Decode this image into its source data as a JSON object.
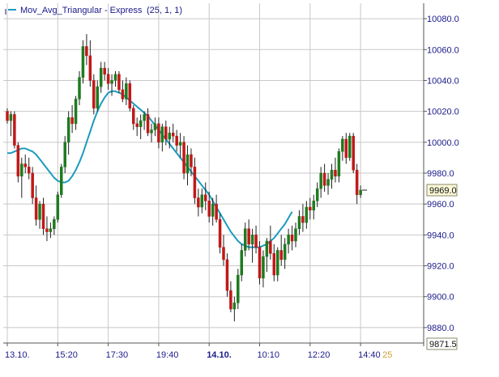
{
  "chart_data": {
    "type": "candlestick",
    "legend": {
      "label": "Mov_Avg_Triangular - Express",
      "params": "(25, 1, 1)",
      "color": "#1b9bbf"
    },
    "ylim": [
      9870,
      10090
    ],
    "y_ticks": [
      9880.0,
      9900.0,
      9920.0,
      9940.0,
      9960.0,
      9980.0,
      10000.0,
      10020.0,
      10040.0,
      10060.0,
      10080.0
    ],
    "y_tick_labels": [
      "9880.0",
      "9900.0",
      "9920.0",
      "9940.0",
      "9960.0",
      "9980.0",
      "10000.0",
      "10020.0",
      "10040.0",
      "10060.0",
      "10080.0"
    ],
    "x_ticks": [
      {
        "label": "13.10.",
        "index": 0,
        "bold": false
      },
      {
        "label": "15:20",
        "index": 14,
        "bold": false
      },
      {
        "label": "17:30",
        "index": 28,
        "bold": false
      },
      {
        "label": "19:40",
        "index": 42,
        "bold": false
      },
      {
        "label": "14.10.",
        "index": 56,
        "bold": true
      },
      {
        "label": "10:10",
        "index": 70,
        "bold": false
      },
      {
        "label": "12:20",
        "index": 84,
        "bold": false
      },
      {
        "label": "14:40",
        "index": 98,
        "bold": false
      }
    ],
    "x_extra_label": "25",
    "last_price": "9969.0",
    "min_price_label": "9871.5",
    "colors": {
      "up": "#1e7a1e",
      "down": "#c01818",
      "grid": "#c8c8c8",
      "ma": "#1b9bbf",
      "axis_text": "#1a1a8a"
    },
    "candles": [
      [
        10020,
        10022,
        10012,
        10014
      ],
      [
        10014,
        10020,
        10004,
        10018
      ],
      [
        10018,
        10020,
        9996,
        9998
      ],
      [
        9998,
        10000,
        9974,
        9978
      ],
      [
        9978,
        9990,
        9964,
        9986
      ],
      [
        9986,
        9992,
        9980,
        9984
      ],
      [
        9984,
        9990,
        9976,
        9980
      ],
      [
        9980,
        9984,
        9960,
        9964
      ],
      [
        9964,
        9972,
        9946,
        9950
      ],
      [
        9950,
        9962,
        9944,
        9960
      ],
      [
        9960,
        9964,
        9940,
        9944
      ],
      [
        9944,
        9952,
        9936,
        9942
      ],
      [
        9942,
        9948,
        9938,
        9944
      ],
      [
        9944,
        9952,
        9940,
        9950
      ],
      [
        9950,
        9968,
        9948,
        9966
      ],
      [
        9966,
        9986,
        9964,
        9984
      ],
      [
        9984,
        10004,
        9980,
        10000
      ],
      [
        10000,
        10020,
        9992,
        10016
      ],
      [
        10016,
        10024,
        10006,
        10012
      ],
      [
        10012,
        10030,
        10008,
        10028
      ],
      [
        10028,
        10046,
        10024,
        10042
      ],
      [
        10042,
        10066,
        10038,
        10062
      ],
      [
        10062,
        10070,
        10050,
        10056
      ],
      [
        10056,
        10066,
        10036,
        10040
      ],
      [
        10040,
        10044,
        10018,
        10022
      ],
      [
        10022,
        10040,
        10020,
        10036
      ],
      [
        10036,
        10052,
        10032,
        10048
      ],
      [
        10048,
        10052,
        10040,
        10044
      ],
      [
        10044,
        10048,
        10034,
        10038
      ],
      [
        10038,
        10044,
        10030,
        10040
      ],
      [
        10040,
        10046,
        10036,
        10044
      ],
      [
        10044,
        10046,
        10032,
        10034
      ],
      [
        10034,
        10040,
        10026,
        10028
      ],
      [
        10028,
        10042,
        10024,
        10038
      ],
      [
        10038,
        10040,
        10020,
        10022
      ],
      [
        10022,
        10024,
        10008,
        10012
      ],
      [
        10012,
        10016,
        10004,
        10010
      ],
      [
        10010,
        10018,
        10002,
        10014
      ],
      [
        10014,
        10020,
        10008,
        10018
      ],
      [
        10018,
        10022,
        10004,
        10006
      ],
      [
        10006,
        10012,
        10000,
        10008
      ],
      [
        10008,
        10016,
        10004,
        10012
      ],
      [
        10012,
        10016,
        9996,
        10000
      ],
      [
        10000,
        10012,
        9994,
        10010
      ],
      [
        10010,
        10014,
        9998,
        10002
      ],
      [
        10002,
        10010,
        9996,
        10006
      ],
      [
        10006,
        10012,
        10000,
        10004
      ],
      [
        10004,
        10008,
        9994,
        9998
      ],
      [
        9998,
        10006,
        9990,
        10000
      ],
      [
        10000,
        10004,
        9976,
        9980
      ],
      [
        9980,
        9998,
        9972,
        9992
      ],
      [
        9992,
        9996,
        9978,
        9984
      ],
      [
        9984,
        9990,
        9960,
        9964
      ],
      [
        9964,
        9970,
        9952,
        9958
      ],
      [
        9958,
        9970,
        9954,
        9966
      ],
      [
        9966,
        9974,
        9956,
        9962
      ],
      [
        9962,
        9968,
        9948,
        9952
      ],
      [
        9952,
        9964,
        9946,
        9960
      ],
      [
        9960,
        9966,
        9948,
        9950
      ],
      [
        9950,
        9954,
        9928,
        9932
      ],
      [
        9932,
        9940,
        9920,
        9924
      ],
      [
        9924,
        9928,
        9900,
        9904
      ],
      [
        9904,
        9910,
        9890,
        9892
      ],
      [
        9892,
        9900,
        9884,
        9896
      ],
      [
        9896,
        9918,
        9892,
        9914
      ],
      [
        9914,
        9934,
        9910,
        9930
      ],
      [
        9930,
        9948,
        9926,
        9944
      ],
      [
        9944,
        9950,
        9930,
        9934
      ],
      [
        9934,
        9944,
        9922,
        9940
      ],
      [
        9940,
        9946,
        9928,
        9932
      ],
      [
        9932,
        9936,
        9908,
        9912
      ],
      [
        9912,
        9930,
        9906,
        9926
      ],
      [
        9926,
        9938,
        9916,
        9936
      ],
      [
        9936,
        9946,
        9924,
        9928
      ],
      [
        9928,
        9934,
        9910,
        9914
      ],
      [
        9914,
        9932,
        9910,
        9930
      ],
      [
        9930,
        9940,
        9920,
        9924
      ],
      [
        9924,
        9938,
        9918,
        9934
      ],
      [
        9934,
        9944,
        9928,
        9940
      ],
      [
        9940,
        9946,
        9930,
        9936
      ],
      [
        9936,
        9948,
        9932,
        9944
      ],
      [
        9944,
        9956,
        9940,
        9952
      ],
      [
        9952,
        9960,
        9942,
        9948
      ],
      [
        9948,
        9962,
        9944,
        9958
      ],
      [
        9958,
        9964,
        9950,
        9956
      ],
      [
        9956,
        9966,
        9950,
        9962
      ],
      [
        9962,
        9974,
        9958,
        9970
      ],
      [
        9970,
        9984,
        9964,
        9980
      ],
      [
        9980,
        9986,
        9968,
        9972
      ],
      [
        9972,
        9980,
        9966,
        9976
      ],
      [
        9976,
        9986,
        9970,
        9982
      ],
      [
        9982,
        9990,
        9974,
        9978
      ],
      [
        9978,
        9996,
        9974,
        9994
      ],
      [
        9994,
        10004,
        9988,
        10002
      ],
      [
        10002,
        10006,
        9986,
        9990
      ],
      [
        9990,
        10006,
        9988,
        10004
      ],
      [
        10004,
        10006,
        9980,
        9982
      ],
      [
        9982,
        9986,
        9960,
        9966
      ],
      [
        9966,
        9972,
        9964,
        9969
      ]
    ],
    "ma": [
      9993,
      9993,
      9994,
      9995,
      9996,
      9996,
      9995,
      9994,
      9992,
      9989,
      9986,
      9983,
      9980,
      9977,
      9975,
      9974,
      9974,
      9975,
      9978,
      9982,
      9987,
      9993,
      10000,
      10007,
      10014,
      10020,
      10025,
      10029,
      10032,
      10033,
      10033,
      10032,
      10031,
      10029,
      10027,
      10025,
      10023,
      10021,
      10019,
      10017,
      10014,
      10011,
      10008,
      10005,
      10002,
      9999,
      9996,
      9993,
      9990,
      9987,
      9984,
      9981,
      9978,
      9975,
      9972,
      9969,
      9966,
      9962,
      9958,
      9954,
      9950,
      9946,
      9942,
      9939,
      9936,
      9934,
      9933,
      9932,
      9932,
      9932,
      9932,
      9933,
      9934,
      9936,
      9938,
      9941,
      9944,
      9947,
      9951,
      9955
    ],
    "ma_start_index": 0
  }
}
